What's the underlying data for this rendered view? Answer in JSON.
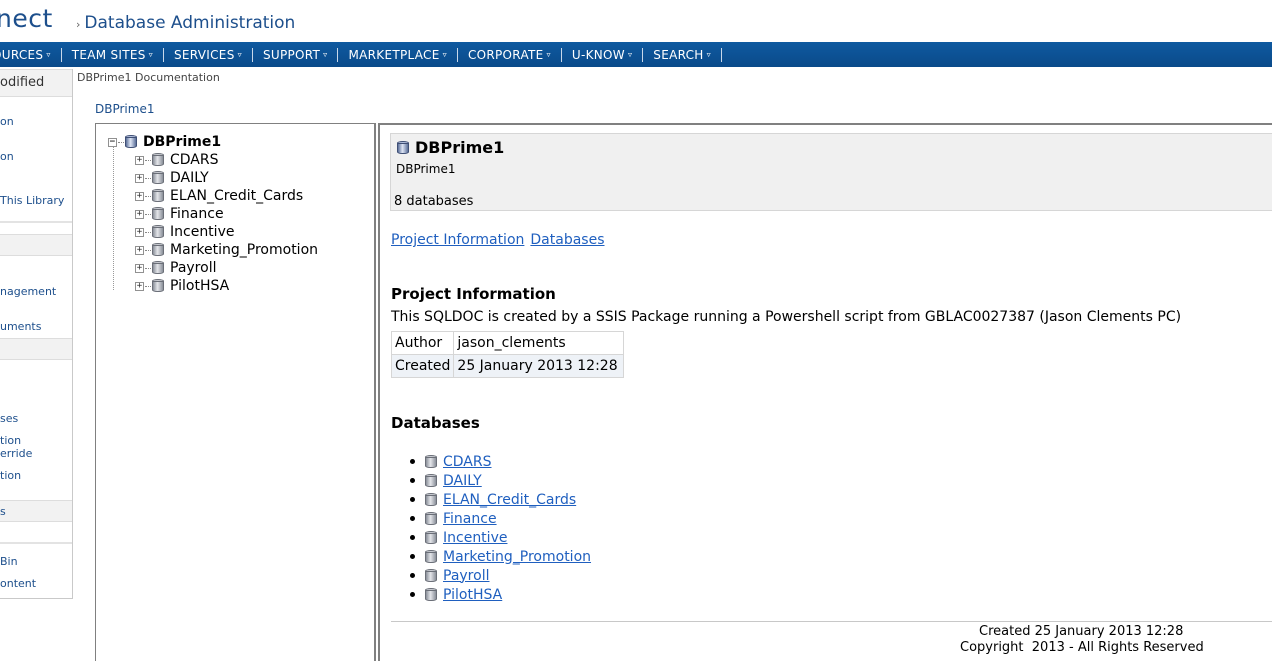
{
  "header": {
    "brand_fragment": "nect",
    "site_title": "Database Administration",
    "title_chevron": "›"
  },
  "topnav": {
    "items": [
      {
        "label": "OURCES"
      },
      {
        "label": "TEAM SITES"
      },
      {
        "label": "SERVICES"
      },
      {
        "label": "SUPPORT"
      },
      {
        "label": "MARKETPLACE"
      },
      {
        "label": "CORPORATE"
      },
      {
        "label": "U-KNOW"
      },
      {
        "label": "SEARCH"
      }
    ],
    "caret": "▿"
  },
  "leftnav": {
    "title": "odified",
    "links": [
      {
        "label": "on"
      },
      {
        "label": "on"
      },
      {
        "label": "This Library"
      },
      {
        "label": "nagement"
      },
      {
        "label": "uments"
      },
      {
        "label": "ses"
      },
      {
        "label": "tion"
      },
      {
        "label": "erride"
      },
      {
        "label": "tion"
      },
      {
        "label": "s"
      },
      {
        "label": "Bin"
      },
      {
        "label": "ontent"
      }
    ]
  },
  "breadcrumb": "DBPrime1 Documentation",
  "db_link": "DBPrime1",
  "tree": {
    "root": "DBPrime1",
    "root_expander": "−",
    "child_expander": "+",
    "children": [
      "CDARS",
      "DAILY",
      "ELAN_Credit_Cards",
      "Finance",
      "Incentive",
      "Marketing_Promotion",
      "Payroll",
      "PilotHSA"
    ]
  },
  "summary": {
    "title": "DBPrime1",
    "subtitle": "DBPrime1",
    "count": "8 databases"
  },
  "anchors": {
    "project_info": "Project Information",
    "databases": "Databases"
  },
  "project": {
    "heading": "Project Information",
    "description": "This SQLDOC is created by a SSIS Package running a Powershell script from GBLAC0027387 (Jason Clements PC)",
    "rows": [
      {
        "label": "Author",
        "value": "jason_clements"
      },
      {
        "label": "Created",
        "value": "25 January 2013 12:28"
      }
    ]
  },
  "databases": {
    "heading": "Databases",
    "items": [
      "CDARS",
      "DAILY",
      "ELAN_Credit_Cards",
      "Finance",
      "Incentive",
      "Marketing_Promotion",
      "Payroll",
      "PilotHSA"
    ]
  },
  "footer": {
    "created": "Created 25 January 2013 12:28",
    "copyright": "Copyright  2013 - All Rights Reserved"
  },
  "colors": {
    "nav_bg": "#0b5394",
    "brand": "#1d4f8c",
    "link": "#1f5fbf"
  }
}
